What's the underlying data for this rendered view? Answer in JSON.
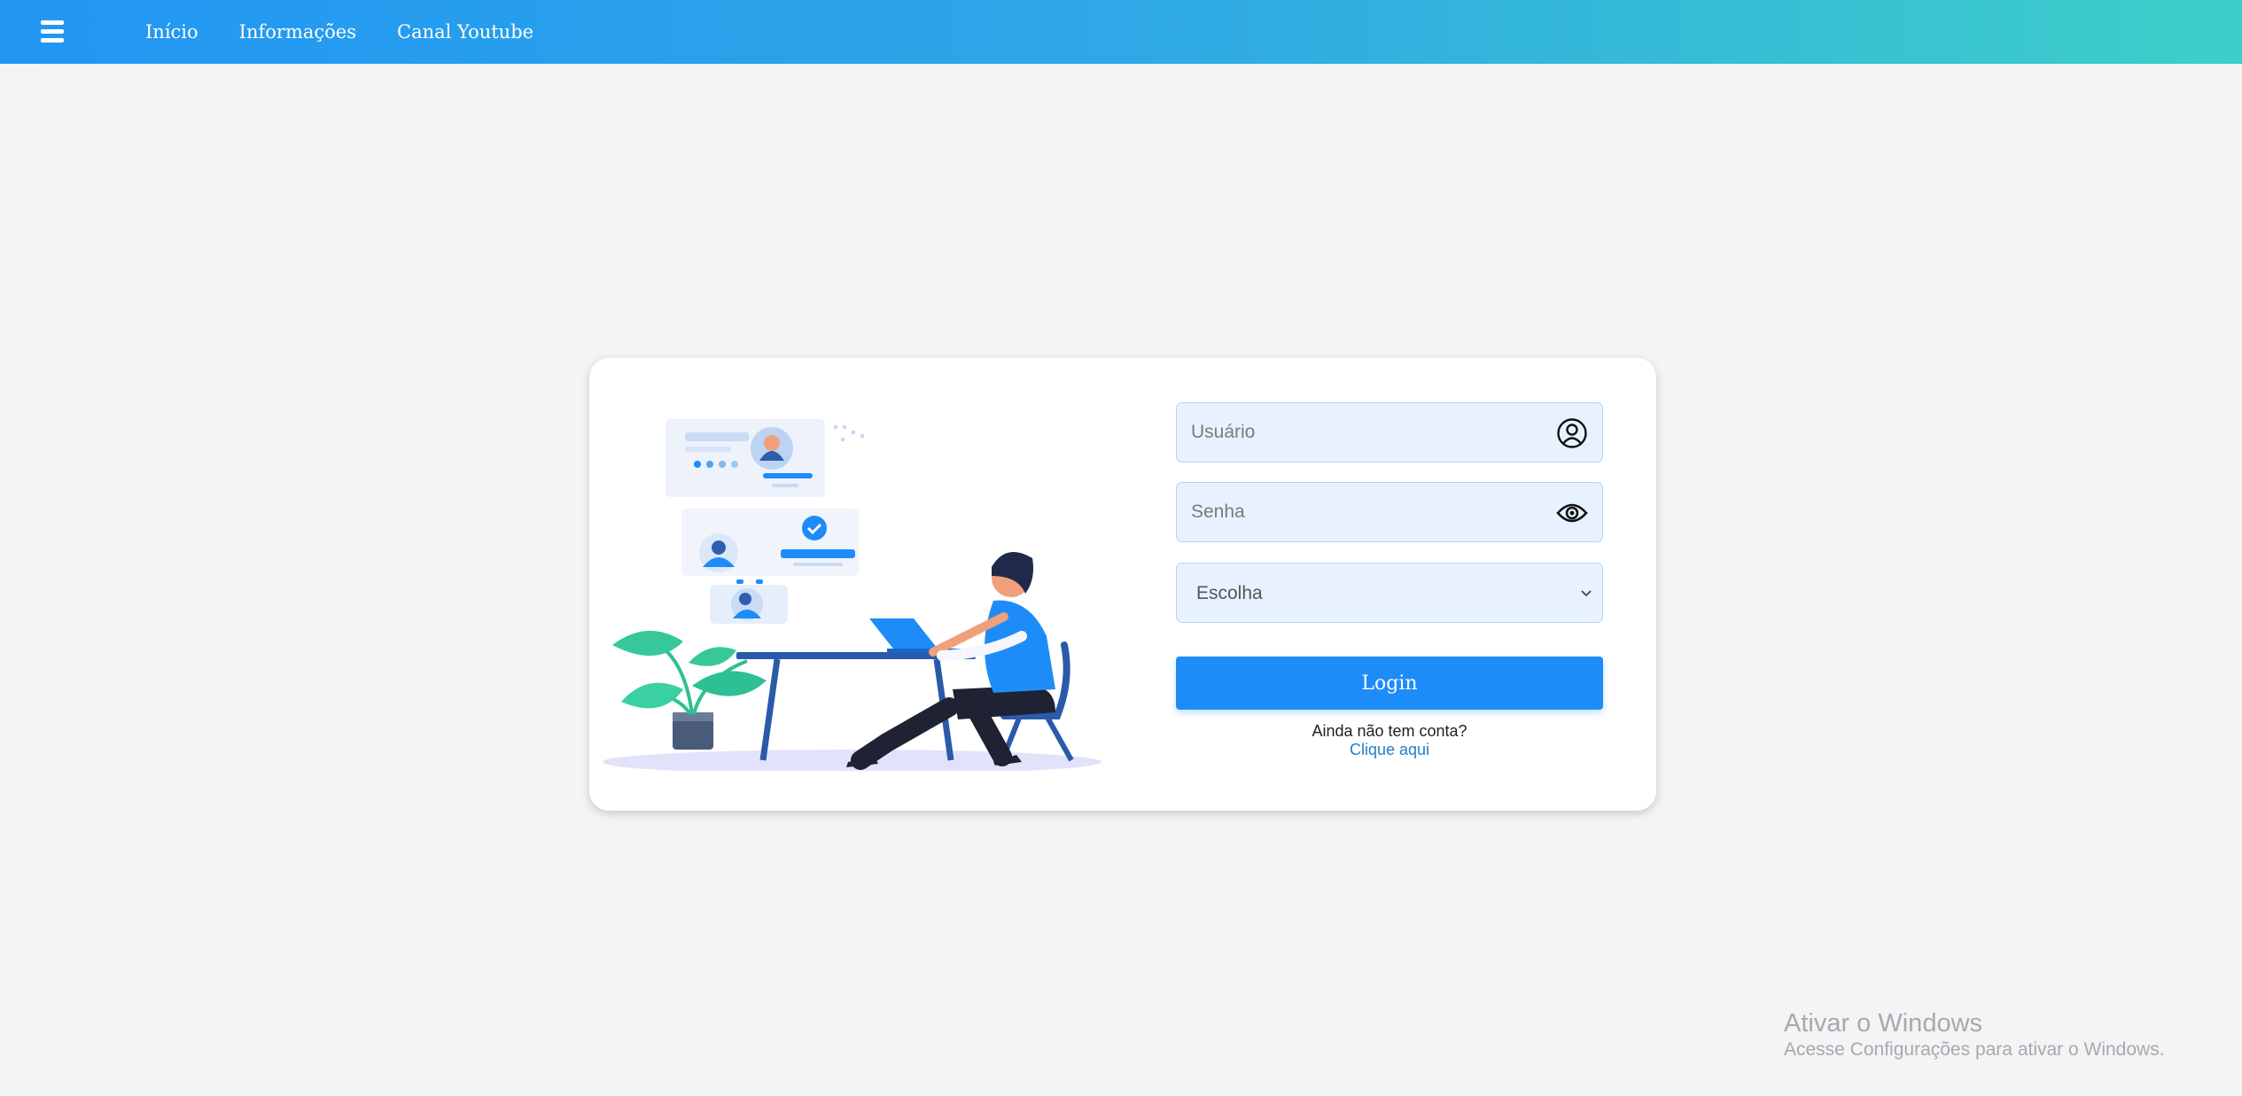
{
  "navbar": {
    "menu_icon": "hamburger-menu-icon",
    "links": [
      "Início",
      "Informações",
      "Canal Youtube"
    ]
  },
  "login_card": {
    "illustration": "person-working-at-laptop-illustration",
    "username": {
      "placeholder": "Usuário",
      "value": "",
      "icon": "user-circle-icon"
    },
    "password": {
      "placeholder": "Senha",
      "value": "",
      "icon": "eye-icon"
    },
    "choice": {
      "selected": "Escolha",
      "icon": "chevron-down-icon"
    },
    "login_label": "Login",
    "signup_question": "Ainda não tem conta?",
    "signup_link": "Clique aqui"
  },
  "watermark": {
    "title": "Ativar o Windows",
    "subtitle": "Acesse Configurações para ativar o Windows."
  },
  "colors": {
    "navbar_gradient_start": "#2196f3",
    "navbar_gradient_end": "#3ccfc8",
    "button": "#1e8cf8",
    "input_background": "#e8f2fe",
    "page_background": "#f3f4f6"
  }
}
